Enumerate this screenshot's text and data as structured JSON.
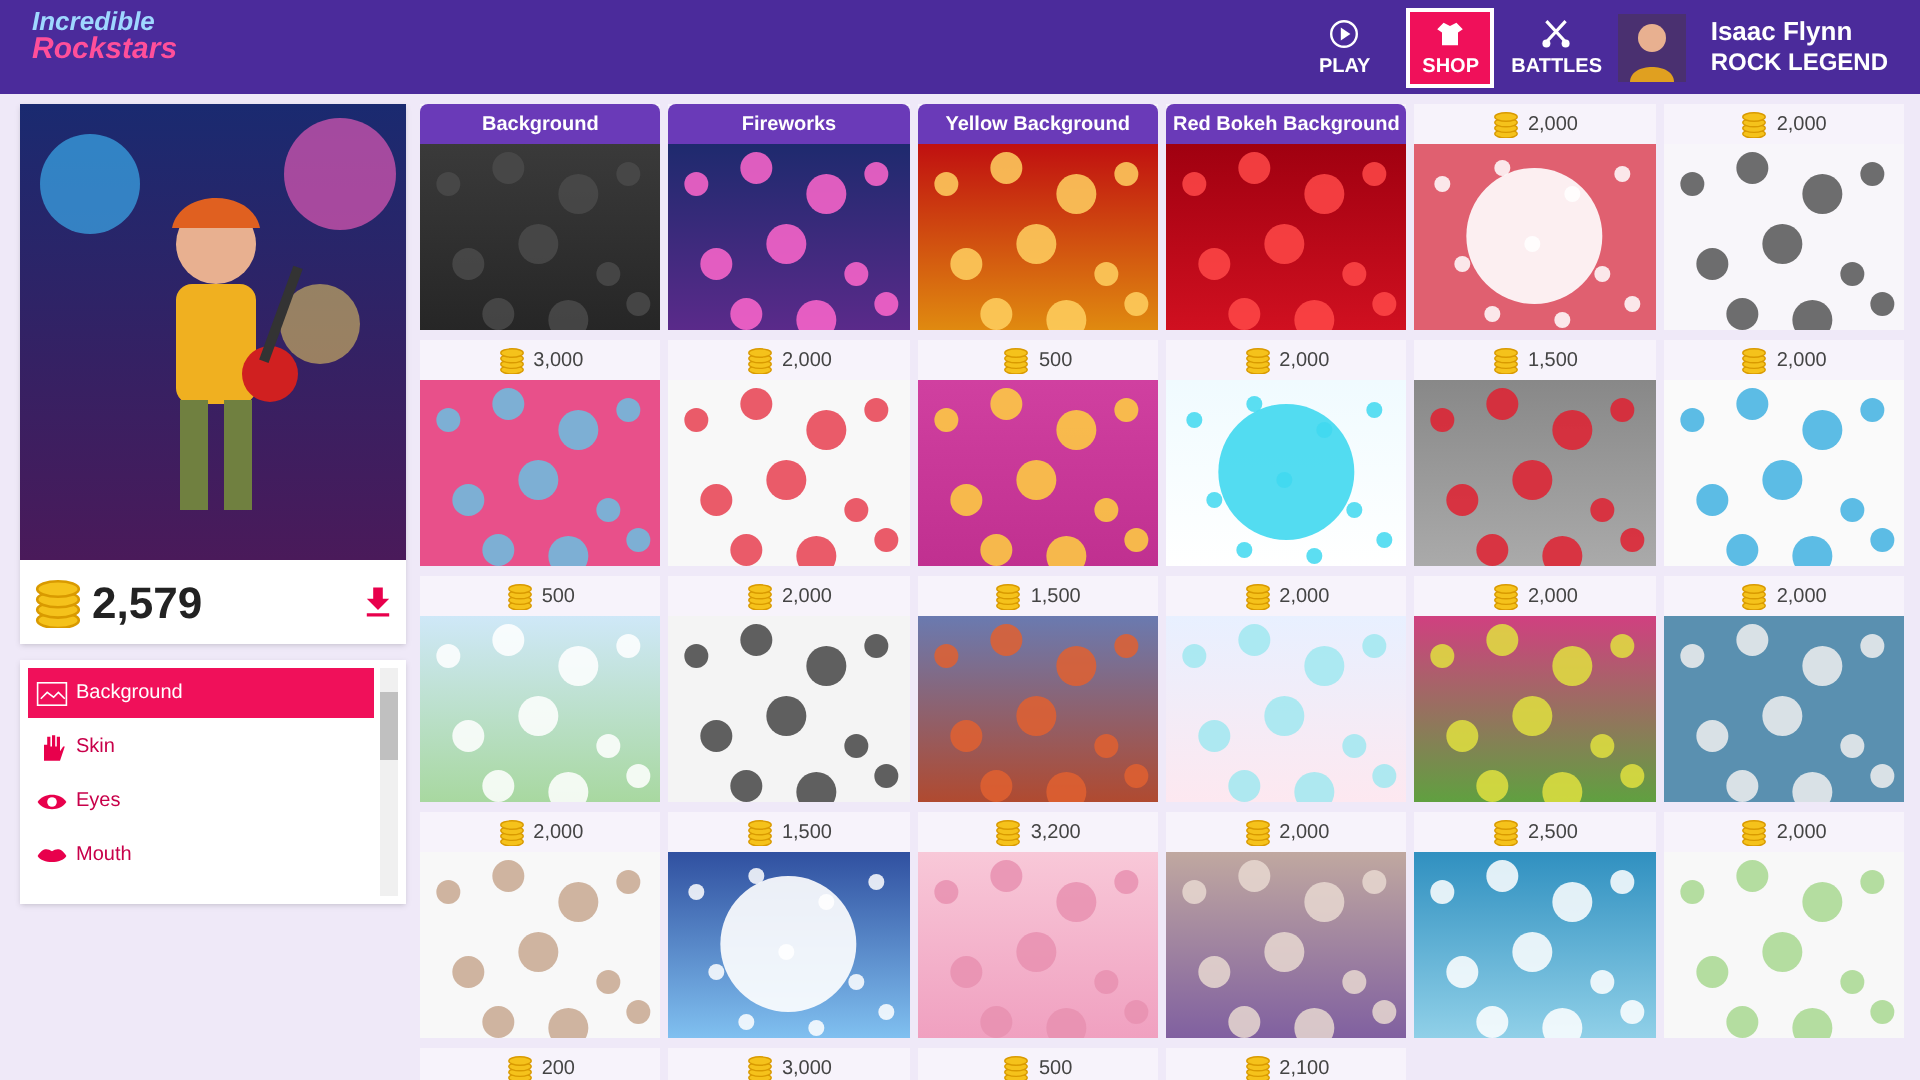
{
  "header": {
    "logo_top": "Incredible",
    "logo_bottom": "Rockstars",
    "nav": [
      {
        "label": "PLAY",
        "kind": "play",
        "selected": false
      },
      {
        "label": "SHOP",
        "kind": "shop",
        "selected": true
      },
      {
        "label": "BATTLES",
        "kind": "battles",
        "selected": false
      }
    ],
    "user": {
      "name": "Isaac Flynn",
      "rank": "ROCK LEGEND"
    }
  },
  "profile": {
    "coins": "2,579"
  },
  "categories": [
    {
      "label": "Background",
      "kind": "picture",
      "selected": true
    },
    {
      "label": "Skin",
      "kind": "hand",
      "selected": false
    },
    {
      "label": "Eyes",
      "kind": "eye",
      "selected": false
    },
    {
      "label": "Mouth",
      "kind": "lips",
      "selected": false
    }
  ],
  "items": [
    {
      "title": "Background",
      "kind": "picture"
    },
    {
      "title": "Fireworks",
      "kind": "picture"
    },
    {
      "title": "Yellow Background",
      "kind": "picture"
    },
    {
      "title": "Red Bokeh Background",
      "kind": "picture"
    },
    {
      "price": "2,000",
      "kind": "picture"
    },
    {
      "price": "2,000",
      "kind": "picture"
    },
    {
      "price": "3,000",
      "kind": "picture"
    },
    {
      "price": "2,000",
      "kind": "picture"
    },
    {
      "price": "500",
      "kind": "picture"
    },
    {
      "price": "2,000",
      "kind": "picture"
    },
    {
      "price": "1,500",
      "kind": "picture"
    },
    {
      "price": "2,000",
      "kind": "picture"
    },
    {
      "price": "500",
      "kind": "picture"
    },
    {
      "price": "2,000",
      "kind": "picture"
    },
    {
      "price": "1,500",
      "kind": "picture"
    },
    {
      "price": "2,000",
      "kind": "picture"
    },
    {
      "price": "2,000",
      "kind": "picture"
    },
    {
      "price": "2,000",
      "kind": "picture"
    },
    {
      "price": "2,000",
      "kind": "picture"
    },
    {
      "price": "1,500",
      "kind": "picture"
    },
    {
      "price": "3,200",
      "kind": "picture"
    },
    {
      "price": "2,000",
      "kind": "picture"
    },
    {
      "price": "2,500",
      "kind": "picture"
    },
    {
      "price": "2,000",
      "kind": "picture"
    },
    {
      "price": "200"
    },
    {
      "price": "3,000"
    },
    {
      "price": "500"
    },
    {
      "price": "2,100"
    }
  ]
}
